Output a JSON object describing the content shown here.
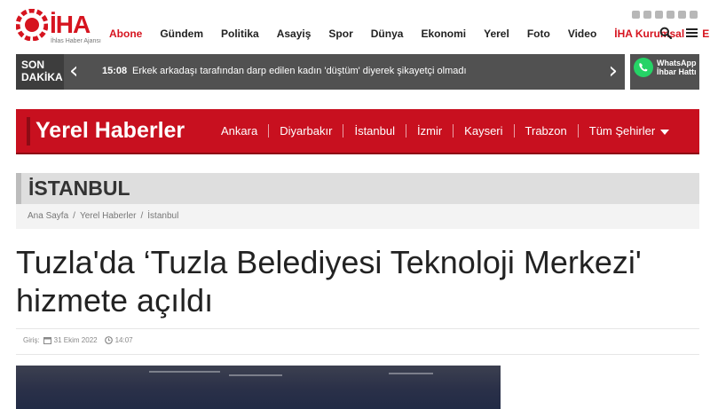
{
  "header": {
    "logo_text": "İHA",
    "logo_sub": "İhlas Haber Ajansı",
    "nav": [
      {
        "label": "Abone",
        "accent": true
      },
      {
        "label": "Gündem",
        "accent": false
      },
      {
        "label": "Politika",
        "accent": false
      },
      {
        "label": "Asayiş",
        "accent": false
      },
      {
        "label": "Spor",
        "accent": false
      },
      {
        "label": "Dünya",
        "accent": false
      },
      {
        "label": "Ekonomi",
        "accent": false
      },
      {
        "label": "Yerel",
        "accent": false
      },
      {
        "label": "Foto",
        "accent": false
      },
      {
        "label": "Video",
        "accent": false
      },
      {
        "label": "İHA Kurumsal",
        "accent": true
      },
      {
        "label": "EN",
        "accent": true
      }
    ],
    "social_icons": [
      "flickr-icon",
      "twitter-icon",
      "linkedin-icon",
      "instagram-icon",
      "youtube-icon",
      "rss-icon"
    ],
    "tools": [
      "search-icon",
      "menu-icon"
    ]
  },
  "breaking": {
    "label_line1": "SON",
    "label_line2": "DAKİKA",
    "time": "15:08",
    "headline": "Erkek arkadaşı tarafından darp edilen kadın 'düştüm' diyerek şikayetçi olmadı"
  },
  "whatsapp": {
    "line1": "WhatsApp",
    "line2": "İhbar Hattı"
  },
  "local": {
    "title": "Yerel Haberler",
    "cities": [
      "Ankara",
      "Diyarbakır",
      "İstanbul",
      "İzmir",
      "Kayseri",
      "Trabzon"
    ],
    "all_cities": "Tüm Şehirler"
  },
  "section": {
    "title": "İSTANBUL",
    "breadcrumb": [
      "Ana Sayfa",
      "Yerel Haberler",
      "İstanbul"
    ]
  },
  "article": {
    "headline": "Tuzla'da ‘Tuzla Belediyesi Teknoloji Merkezi' hizmete açıldı",
    "meta_label": "Giriş:",
    "date": "31 Ekim 2022",
    "time": "14:07"
  },
  "colors": {
    "brand_red": "#d6141f",
    "local_bar": "#c8101f",
    "breaking_bg": "#515151",
    "whatsapp_green": "#25d366"
  }
}
